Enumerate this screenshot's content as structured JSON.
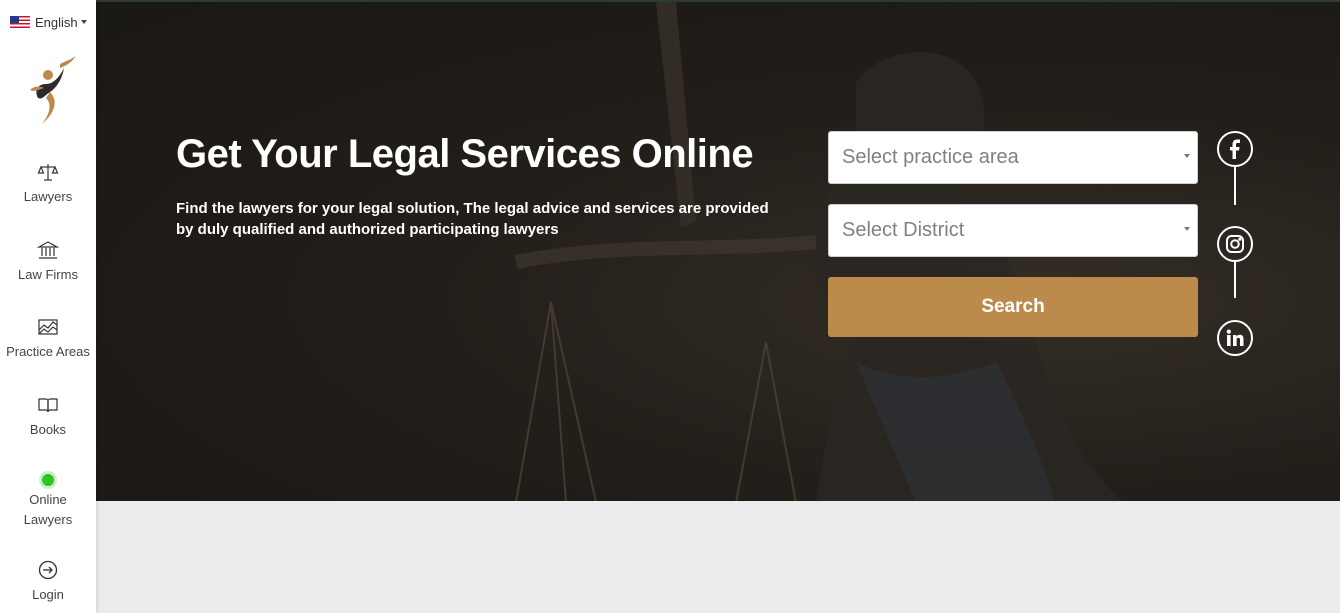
{
  "language": {
    "label": "English",
    "flag_icon": "us-flag-icon"
  },
  "sidebar": {
    "items": [
      {
        "label": "Lawyers",
        "icon": "scales-icon"
      },
      {
        "label": "Law Firms",
        "icon": "bank-building-icon"
      },
      {
        "label": "Practice Areas",
        "icon": "area-chart-icon"
      },
      {
        "label": "Books",
        "icon": "open-book-icon"
      },
      {
        "label": "Online Lawyers",
        "icon": "online-status-dot-icon"
      },
      {
        "label": "Login",
        "icon": "login-arrow-icon"
      }
    ]
  },
  "hero": {
    "title": "Get Your Legal Services Online",
    "description": "Find the lawyers for your legal solution, The legal advice and services are provided by duly qualified and authorized participating lawyers"
  },
  "search": {
    "practice_area_placeholder": "Select practice area",
    "district_placeholder": "Select District",
    "button_label": "Search"
  },
  "social": [
    "facebook-icon",
    "instagram-icon",
    "linkedin-icon"
  ],
  "colors": {
    "accent": "#bc8b4c",
    "online": "#2fc41e",
    "sidebar_bg": "#ffffff",
    "page_bg": "#ececec"
  }
}
